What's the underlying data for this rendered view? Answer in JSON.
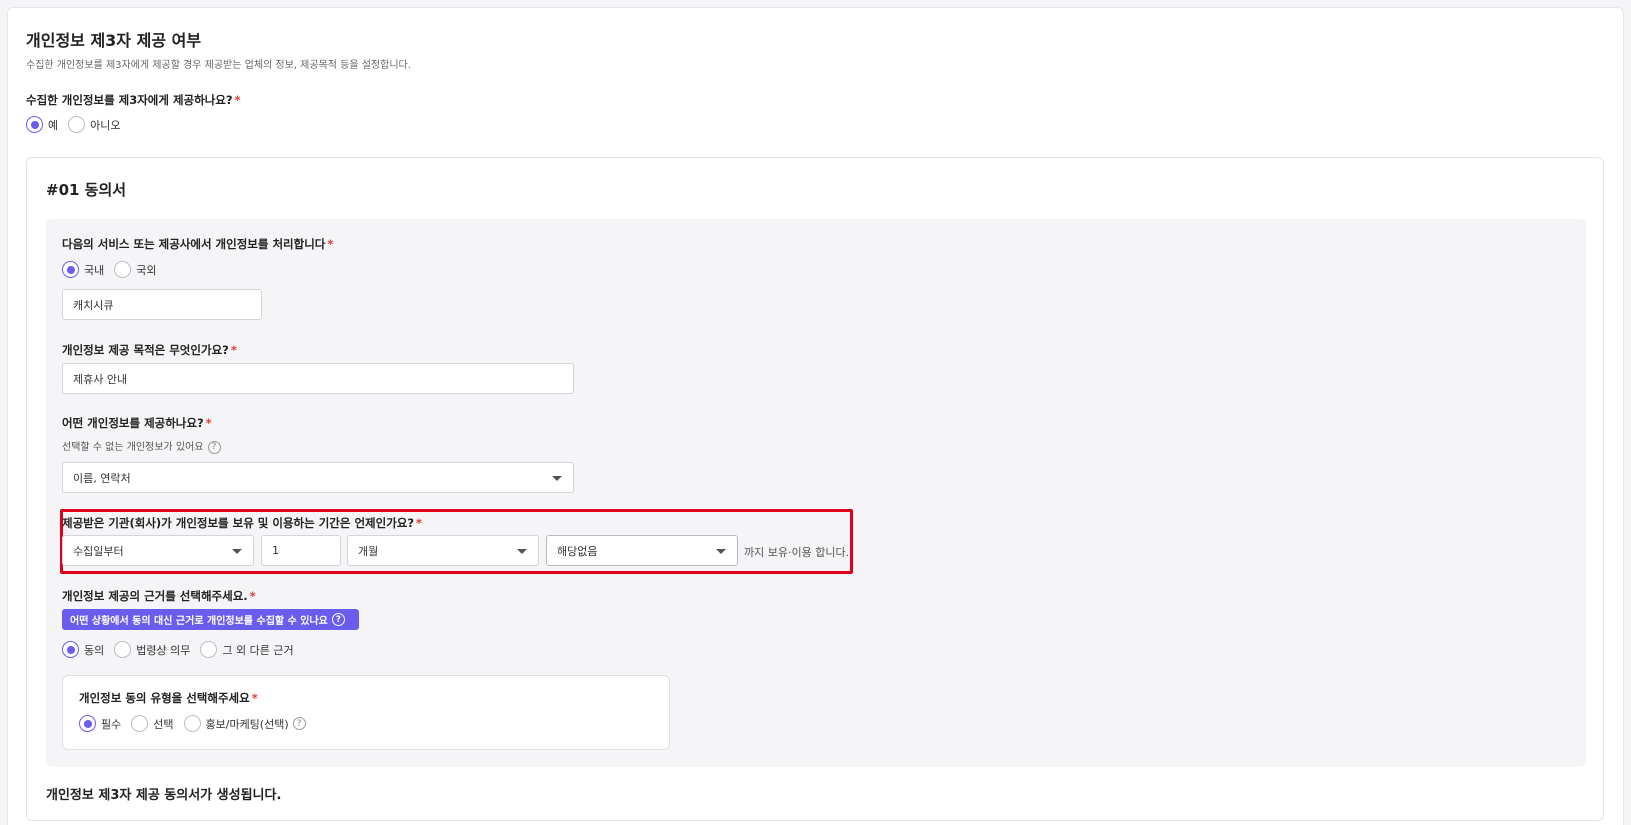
{
  "section": {
    "title": "개인정보 제3자 제공 여부",
    "description": "수집한 개인정보를 제3자에게 제공할 경우 제공받는 업체의 정보, 제공목적 등을 설정합니다."
  },
  "provide_question": {
    "label": "수집한 개인정보를 제3자에게 제공하나요?",
    "options": [
      {
        "label": "예",
        "checked": true
      },
      {
        "label": "아니오",
        "checked": false
      }
    ]
  },
  "agreement": {
    "title": "#01 동의서",
    "processor": {
      "label": "다음의 서비스 또는 제공사에서 개인정보를 처리합니다",
      "options": [
        {
          "label": "국내",
          "checked": true
        },
        {
          "label": "국외",
          "checked": false
        }
      ],
      "value": "캐치시큐"
    },
    "purpose": {
      "label": "개인정보 제공 목적은 무엇인가요?",
      "value": "제휴사 안내"
    },
    "items": {
      "label": "어떤 개인정보를 제공하나요?",
      "sub": "선택할 수 없는 개인정보가 있어요",
      "value": "이름, 연락처"
    },
    "retention": {
      "label": "제공받은 기관(회사)가 개인정보를 보유 및 이용하는 기간은 언제인가요?",
      "start": "수집일부터",
      "amount": "1",
      "unit": "개월",
      "exception": "해당없음",
      "suffix": "까지 보유·이용 합니다."
    },
    "basis": {
      "label": "개인정보 제공의 근거를 선택해주세요.",
      "info_button": "어떤 상황에서 동의 대신 근거로 개인정보를 수집할 수 있나요",
      "options": [
        {
          "label": "동의",
          "checked": true
        },
        {
          "label": "법령상 의무",
          "checked": false
        },
        {
          "label": "그 외 다른 근거",
          "checked": false
        }
      ]
    },
    "consent_type": {
      "label": "개인정보 동의 유형을 선택해주세요",
      "options": [
        {
          "label": "필수",
          "checked": true
        },
        {
          "label": "선택",
          "checked": false
        },
        {
          "label": "홍보/마케팅(선택)",
          "checked": false
        }
      ]
    },
    "footer": "개인정보 제3자 제공 동의서가 생성됩니다."
  },
  "colors": {
    "accent": "#6b5cf0",
    "required": "#e53935",
    "highlight": "#e0001b"
  }
}
